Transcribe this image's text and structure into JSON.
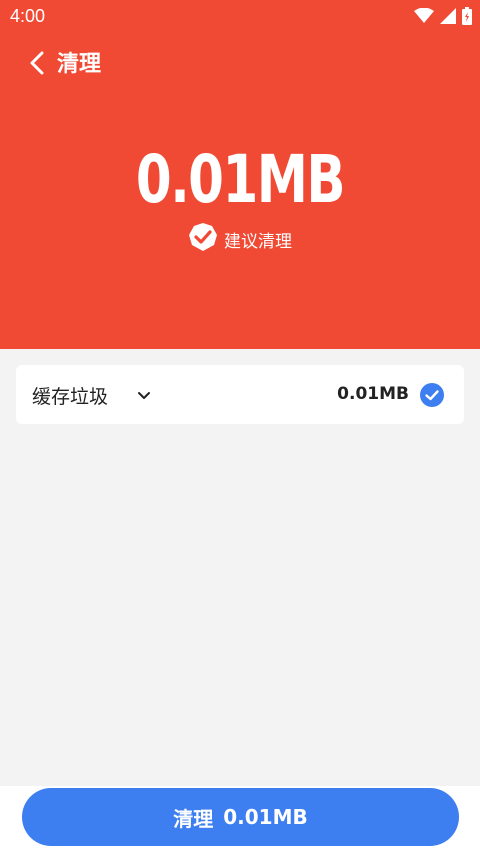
{
  "status_bar": {
    "time": "4:00"
  },
  "toolbar": {
    "title": "清理"
  },
  "summary": {
    "size": "0.01MB",
    "suggest_label": "建议清理"
  },
  "items": [
    {
      "label": "缓存垃圾",
      "size": "0.01MB",
      "checked": true
    }
  ],
  "action": {
    "label": "清理",
    "size": "0.01MB"
  },
  "colors": {
    "header_bg": "#f04a34",
    "accent": "#3d7ef0",
    "background": "#f3f3f3"
  }
}
